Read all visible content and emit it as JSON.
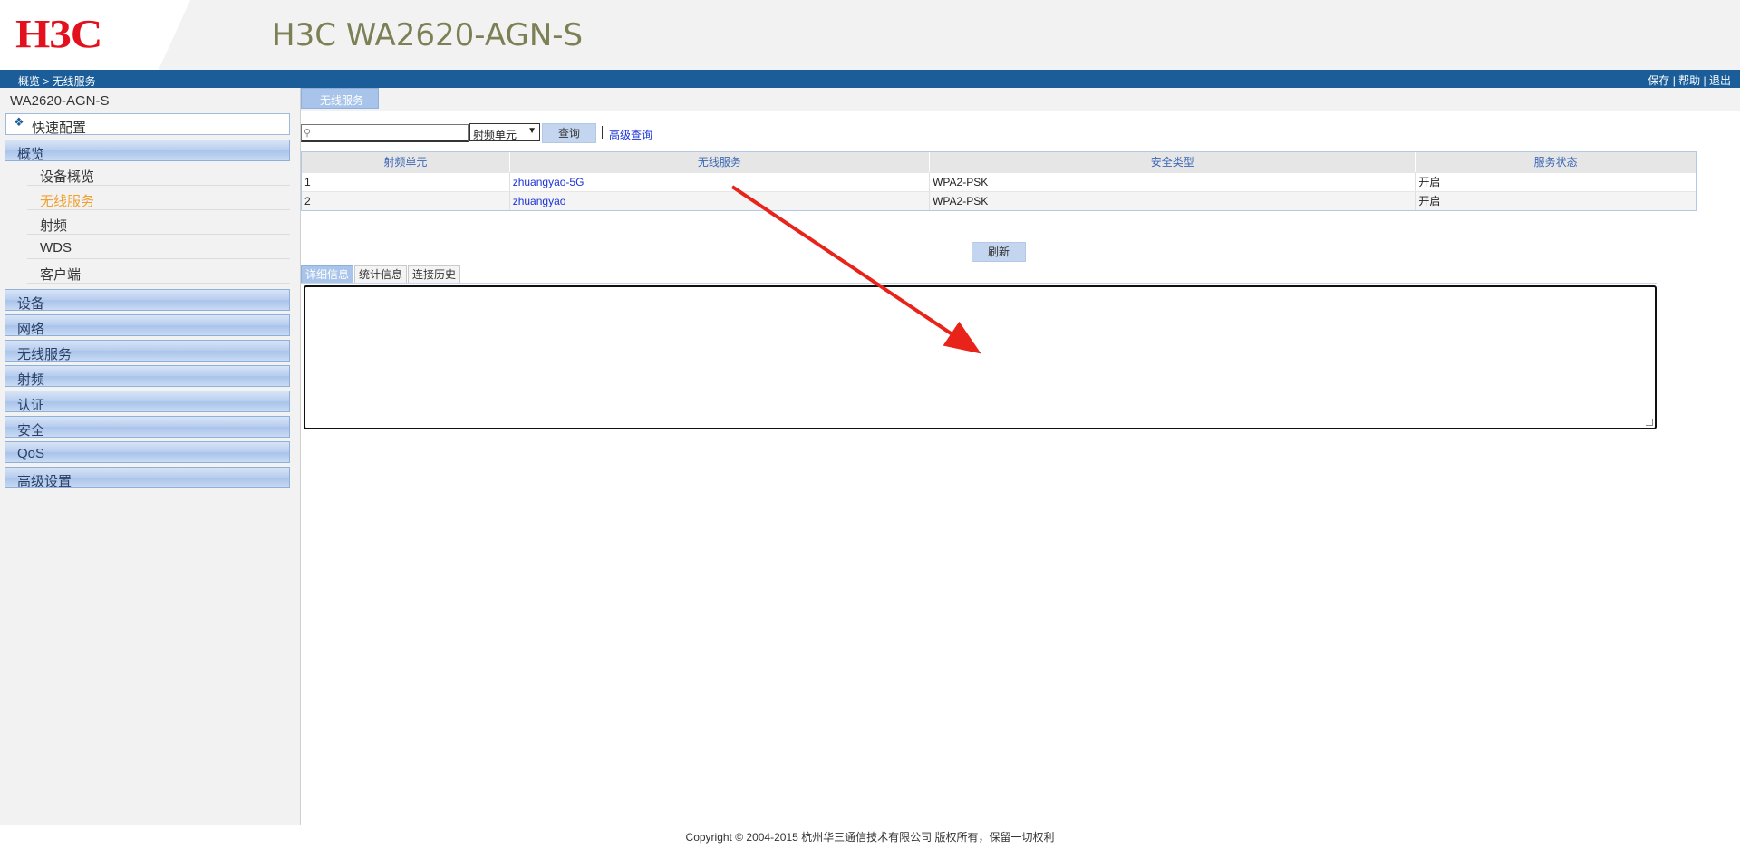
{
  "header": {
    "logo": "H3C",
    "product": "H3C WA2620-AGN-S"
  },
  "topbar": {
    "breadcrumb": "概览 > 无线服务",
    "save": "保存",
    "help": "帮助",
    "logout": "退出",
    "separator": "|"
  },
  "sidebar": {
    "device_name": "WA2620-AGN-S",
    "quick_config": "快速配置",
    "overview": {
      "label": "概览",
      "items": [
        {
          "label": "设备概览"
        },
        {
          "label": "无线服务",
          "active": true
        },
        {
          "label": "射频"
        },
        {
          "label": "WDS"
        },
        {
          "label": "客户端"
        }
      ]
    },
    "sections": [
      {
        "label": "设备"
      },
      {
        "label": "网络"
      },
      {
        "label": "无线服务"
      },
      {
        "label": "射频"
      },
      {
        "label": "认证"
      },
      {
        "label": "安全"
      },
      {
        "label": "QoS"
      },
      {
        "label": "高级设置"
      }
    ]
  },
  "main": {
    "tab": "无线服务",
    "search": {
      "value": "",
      "placeholder": "",
      "field_selected": "射频单元",
      "query_button": "查询",
      "advanced_link": "高级查询"
    },
    "table": {
      "headers": [
        "射频单元",
        "无线服务",
        "安全类型",
        "服务状态"
      ],
      "rows": [
        {
          "radio": "1",
          "ssid": "zhuangyao-5G",
          "security": "WPA2-PSK",
          "status": "开启"
        },
        {
          "radio": "2",
          "ssid": "zhuangyao",
          "security": "WPA2-PSK",
          "status": "开启"
        }
      ]
    },
    "refresh_button": "刷新",
    "detail_tabs": [
      "详细信息",
      "统计信息",
      "连接历史"
    ]
  },
  "footer": {
    "copyright": "Copyright © 2004-2015 杭州华三通信技术有限公司 版权所有，保留一切权利"
  },
  "colors": {
    "topbar": "#1b5d99",
    "logo": "#e3101d",
    "product_title": "#7c8054",
    "active_item": "#f0a030",
    "annotation_arrow": "#e8231a"
  },
  "icons": {
    "quick_config": "diamond-icon",
    "search": "magnifier-icon",
    "select": "chevron-down-icon"
  }
}
